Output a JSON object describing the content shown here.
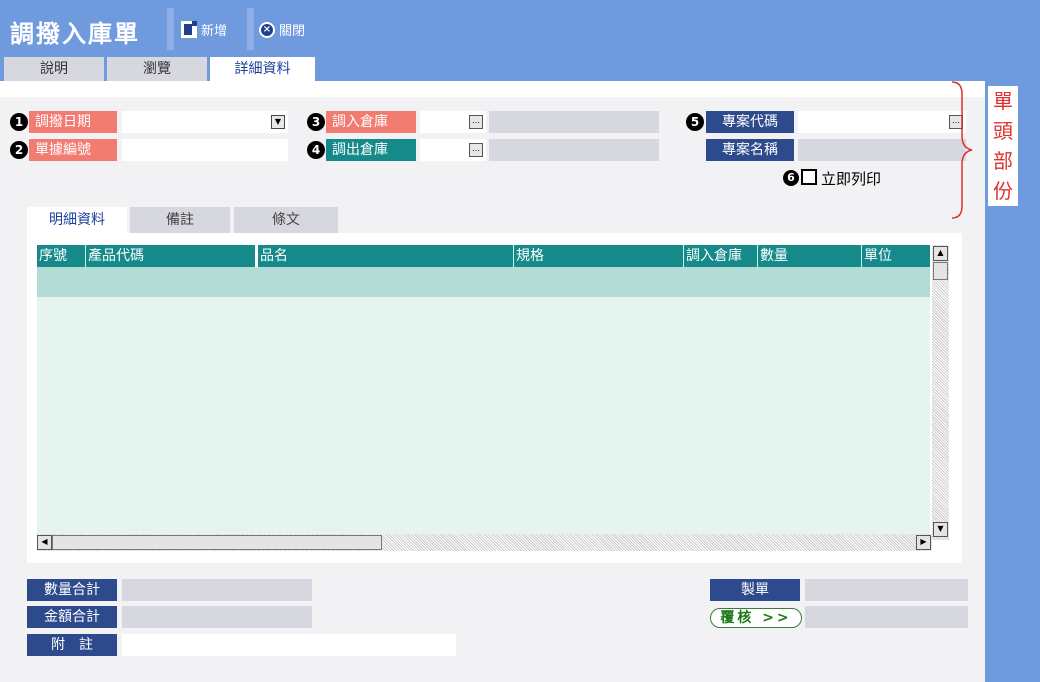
{
  "app": {
    "title": "調撥入庫單"
  },
  "toolbar": {
    "new_label": "新增",
    "close_label": "關閉"
  },
  "top_tabs": [
    "說明",
    "瀏覽",
    "詳細資料"
  ],
  "header": {
    "fields": [
      {
        "num": "1",
        "label": "調撥日期"
      },
      {
        "num": "2",
        "label": "單據編號"
      },
      {
        "num": "3",
        "label": "調入倉庫"
      },
      {
        "num": "4",
        "label": "調出倉庫"
      },
      {
        "num": "5",
        "label": "專案代碼"
      },
      {
        "label": "專案名稱"
      }
    ],
    "print_num": "6",
    "print_label": "立即列印",
    "dropdown_glyph": "▼",
    "lookup_glyph": "…"
  },
  "annotation": {
    "chars": [
      "單",
      "頭",
      "部",
      "份"
    ]
  },
  "sub_tabs": [
    "明細資料",
    "備註",
    "條文"
  ],
  "grid": {
    "columns": [
      "序號",
      "產品代碼",
      "品名",
      "規格",
      "調入倉庫",
      "數量",
      "單位"
    ],
    "scroll_up": "▲",
    "scroll_down": "▼",
    "scroll_left": "◀",
    "scroll_right": "▶"
  },
  "footer": {
    "qty_total": "數量合計",
    "amount_total": "金額合計",
    "note": "附　註",
    "maker": "製單",
    "review": "覆核 >>"
  },
  "colors": {
    "background": "#6f9ade",
    "teal": "#168a8a",
    "red": "#f27b72",
    "navy": "#2d4a8c"
  }
}
